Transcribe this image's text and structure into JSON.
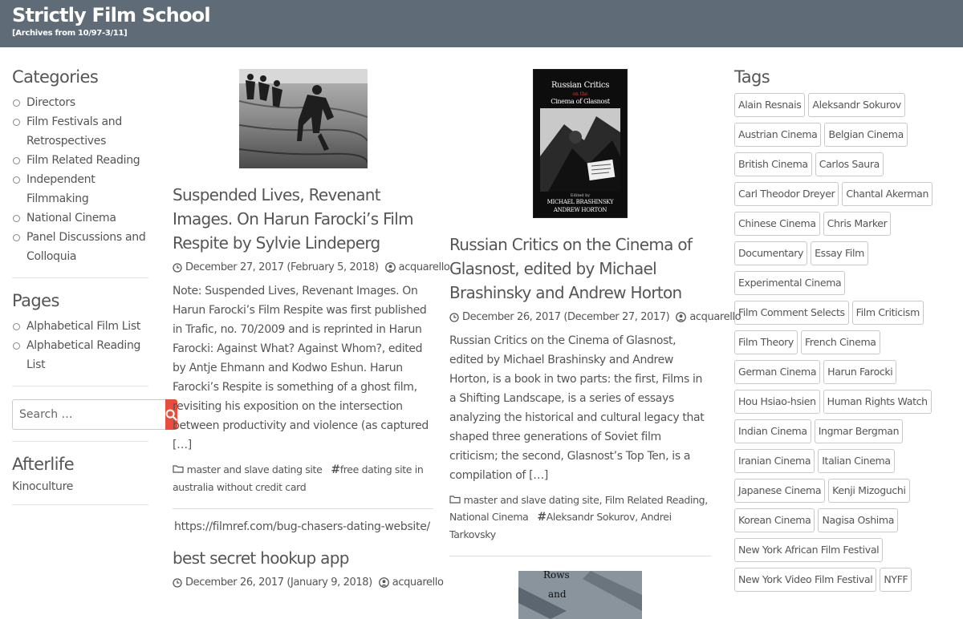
{
  "header": {
    "title": "Strictly Film School",
    "description": "[Archives from 10/97-3/11]",
    "background_color": "#5f6b76"
  },
  "sidebar": {
    "categories_title": "Categories",
    "categories": [
      "Directors",
      "Film Festivals and Retrospectives",
      "Film Related Reading",
      "Independent Filmmaking",
      "National Cinema",
      "Panel Discussions and Colloquia"
    ],
    "pages_title": "Pages",
    "pages": [
      "Alphabetical Film List",
      "Alphabetical Reading List"
    ],
    "search": {
      "placeholder": "Search …",
      "button_color": "#e74c3c"
    },
    "afterlife_title": "Afterlife",
    "afterlife_link": "Kinoculture"
  },
  "posts": {
    "col1": [
      {
        "title": "Suspended Lives, Revenant Images. On Harun Farocki’s Film Respite by Sylvie Lindeperg",
        "date": "December 27, 2017 (February 5, 2018)",
        "author": "acquarello",
        "summary": "Note: Suspended Lives, Revenant Images. On Harun Farocki’s Film Respite was first published in Trafic, no. 70/2009 and is reprinted in Harun Farocki: Against What? Against Whom?, edited by Antje Ehmann and Kodwo Eshun. Harun Farocki’s Respite is something of a ghost film, revisiting his exposition on the intersection between productivity and violence (as captured […]",
        "categories": "master and slave dating site",
        "tags": "free dating site in australia without credit card"
      },
      {
        "url_text": "https://filmref.com/bug-chasers-dating-website/",
        "title": "best secret hookup app",
        "date": "December 26, 2017 (January 9, 2018)",
        "author": "acquarello"
      }
    ],
    "col2": [
      {
        "cover_title_top": "Russian Critics",
        "cover_title_mid": "on the",
        "cover_title_bottom": "Cinema of Glasnost",
        "cover_editors_1": "Edited by",
        "cover_editors_2": "MICHAEL BRASHINSKY",
        "cover_editors_3": "ANDREW HORTON",
        "title": "Russian Critics on the Cinema of Glasnost, edited by Michael Brashinsky and Andrew Horton",
        "date": "December 26, 2017 (December 27, 2017)",
        "author": "acquarello",
        "summary": "Russian Critics on the Cinema of Glasnost, edited by Michael Brashinsky and Andrew Horton, is a book in two parts: the first, Films in a Shifting Landscape, is a series of essays analyzing the historical and cultural legacy that shaped three generations of Soviet film criticism; the second, Glasnost’s Top Ten, is a compilation of […]",
        "categories": "master and slave dating site, Film Related Reading, National Cinema",
        "tags": "Aleksandr Sokurov, Andrei Tarkovsky",
        "next_cover_words": [
          "Rows",
          "and"
        ]
      }
    ]
  },
  "tags_widget": {
    "title": "Tags",
    "items": [
      "Alain Resnais",
      "Aleksandr Sokurov",
      "Austrian Cinema",
      "Belgian Cinema",
      "British Cinema",
      "Carlos Saura",
      "Carl Theodor Dreyer",
      "Chantal Akerman",
      "Chinese Cinema",
      "Chris Marker",
      "Documentary",
      "Essay Film",
      "Experimental Cinema",
      "Film Comment Selects",
      "Film Criticism",
      "Film Theory",
      "French Cinema",
      "German Cinema",
      "Harun Farocki",
      "Hou Hsiao-hsien",
      "Human Rights Watch",
      "Indian Cinema",
      "Ingmar Bergman",
      "Iranian Cinema",
      "Italian Cinema",
      "Japanese Cinema",
      "Kenji Mizoguchi",
      "Korean Cinema",
      "Nagisa Oshima",
      "New York African Film Festival",
      "New York Video Film Festival",
      "NYFF"
    ]
  }
}
